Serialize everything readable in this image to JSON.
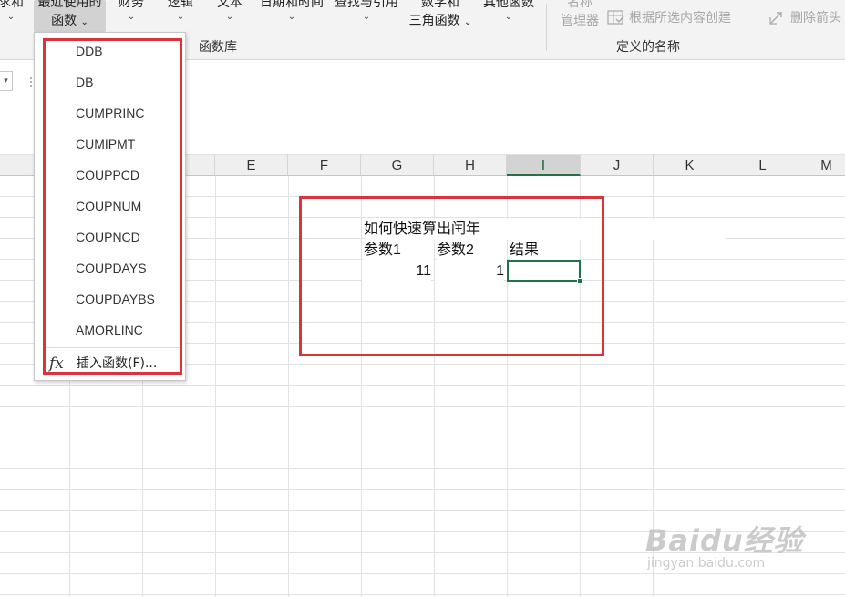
{
  "ribbon": {
    "cut_left_label": "求和",
    "recent_functions_line1": "最近使用的",
    "recent_functions_line2": "函数",
    "financial_label": "财务",
    "logical_label": "逻辑",
    "text_label": "文本",
    "datetime_label": "日期和时间",
    "lookup_label": "查找与引用",
    "math_line1": "数学和",
    "math_line2": "三角函数",
    "other_label": "其他函数",
    "group_function_library": "函数库",
    "name_line1": "名称",
    "name_manager_line2": "管理器",
    "create_from_selection": "根据所选内容创建",
    "group_defined_names": "定义的名称",
    "remove_arrows": "删除箭头",
    "chevron": "⌄"
  },
  "dropdown": {
    "items": [
      "DDB",
      "DB",
      "CUMPRINC",
      "CUMIPMT",
      "COUPPCD",
      "COUPNUM",
      "COUPNCD",
      "COUPDAYS",
      "COUPDAYBS",
      "AMORLINC"
    ],
    "insert_function_label": "插入函数(F)...",
    "fx_icon": "fx"
  },
  "columns": [
    "E",
    "F",
    "G",
    "H",
    "I",
    "J",
    "K",
    "L",
    "M"
  ],
  "partial_col_left": "E",
  "sheet": {
    "title": "如何快速算出闰年",
    "param1_label": "参数1",
    "param2_label": "参数2",
    "result_label": "结果",
    "param1_value": "11",
    "param2_value": "1"
  },
  "watermark": {
    "logo": "Baidu经验",
    "url": "jingyan.baidu.com"
  },
  "colors": {
    "annotation_red": "#d8343a",
    "excel_green": "#217346"
  }
}
